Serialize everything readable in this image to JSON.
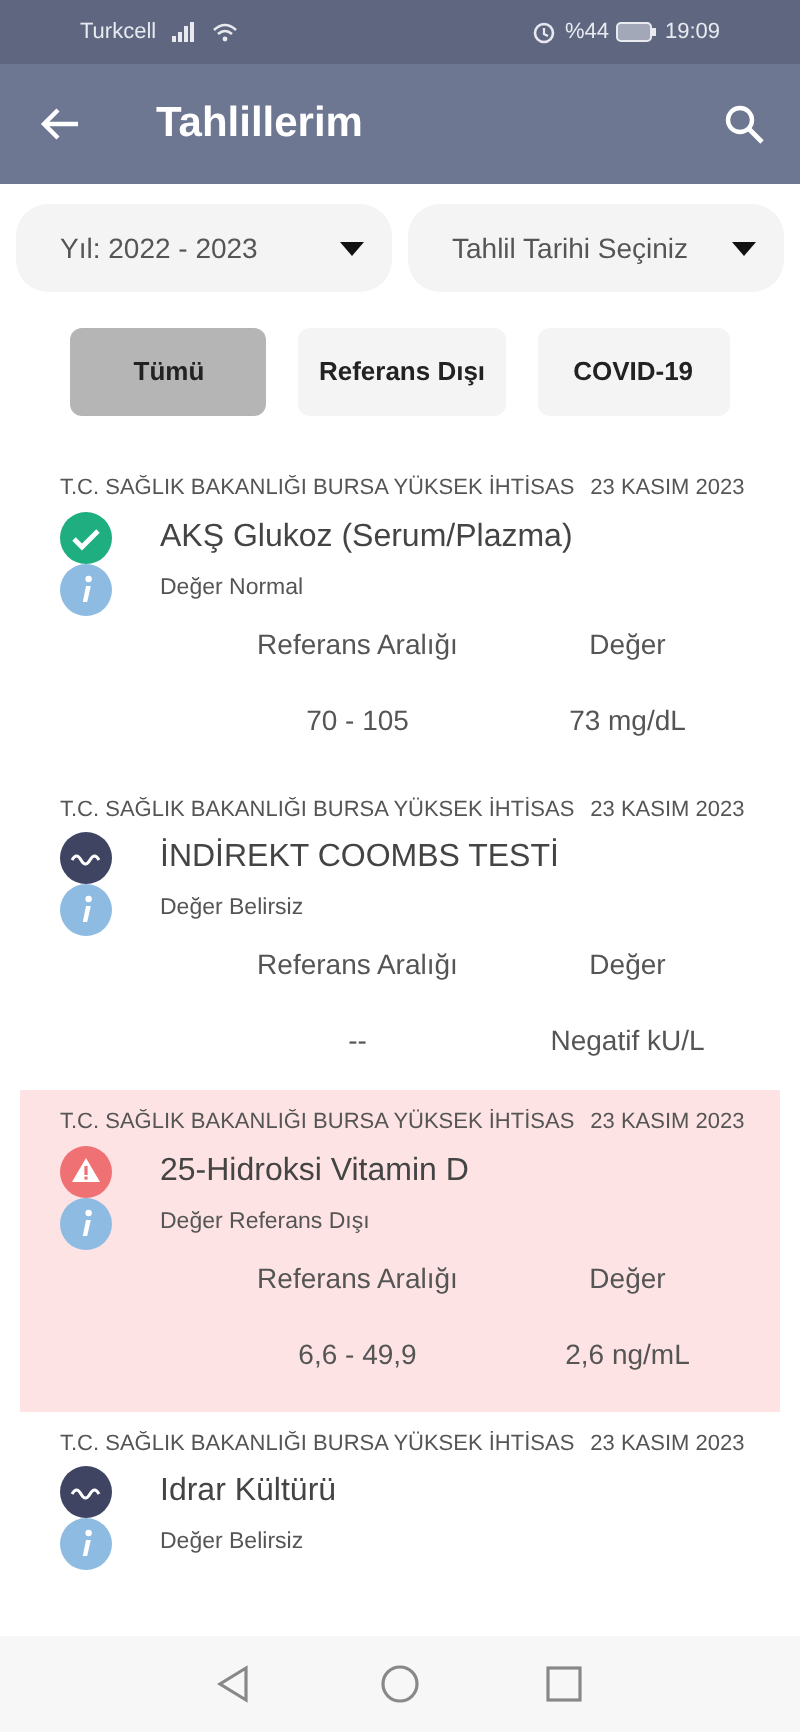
{
  "status_bar": {
    "carrier": "Turkcell",
    "battery_text": "%44",
    "time": "19:09"
  },
  "app_bar": {
    "title": "Tahlillerim"
  },
  "filters": [
    {
      "label": "Yıl: 2022 - 2023"
    },
    {
      "label": "Tahlil Tarihi Seçiniz"
    }
  ],
  "chips": [
    {
      "label": "Tümü",
      "selected": true
    },
    {
      "label": "Referans Dışı",
      "selected": false
    },
    {
      "label": "COVID-19",
      "selected": false
    }
  ],
  "results": [
    {
      "kind": "normal",
      "highlighted": false,
      "institution": "T.C. SAĞLIK BAKANLIĞI BURSA YÜKSEK İHTİSAS",
      "date": "23 KASIM 2023",
      "name": "AKŞ Glukoz (Serum/Plazma)",
      "status": "Değer Normal",
      "range_label": "Referans Aralığı",
      "value_label": "Değer",
      "range": "70 - 105",
      "value": "73 mg/dL"
    },
    {
      "kind": "uncertain",
      "highlighted": false,
      "institution": "T.C. SAĞLIK BAKANLIĞI BURSA YÜKSEK İHTİSAS",
      "date": "23 KASIM 2023",
      "name": "İNDİREKT COOMBS TESTİ",
      "status": "Değer Belirsiz",
      "range_label": "Referans Aralığı",
      "value_label": "Değer",
      "range": "--",
      "value": "Negatif kU/L"
    },
    {
      "kind": "abnormal",
      "highlighted": true,
      "institution": "T.C. SAĞLIK BAKANLIĞI BURSA YÜKSEK İHTİSAS",
      "date": "23 KASIM 2023",
      "name": "25-Hidroksi Vitamin D",
      "status": "Değer Referans Dışı",
      "range_label": "Referans Aralığı",
      "value_label": "Değer",
      "range": "6,6 - 49,9",
      "value": "2,6 ng/mL"
    },
    {
      "kind": "uncertain",
      "highlighted": false,
      "institution": "T.C. SAĞLIK BAKANLIĞI BURSA YÜKSEK İHTİSAS",
      "date": "23 KASIM 2023",
      "name": "Idrar Kültürü",
      "status": "Değer Belirsiz"
    }
  ]
}
